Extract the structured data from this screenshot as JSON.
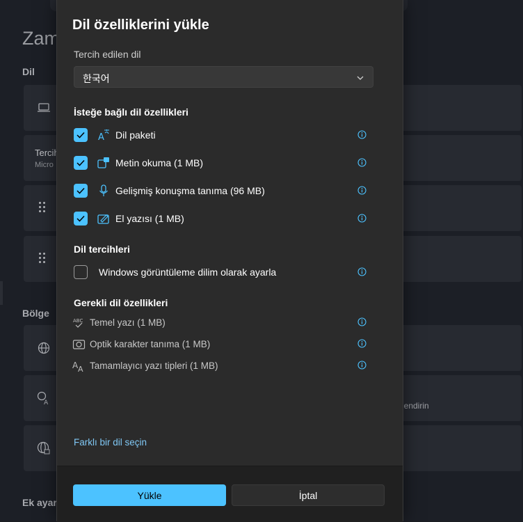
{
  "background": {
    "page_title": "Zam",
    "section_language": "Dil",
    "card_pref_title": "Tercih",
    "card_pref_sub": "Micro",
    "section_region": "Bölge",
    "card_region_text": "mlendirin",
    "section_extra": "Ek ayarl"
  },
  "dialog": {
    "title": "Dil özelliklerini yükle",
    "preferred_label": "Tercih edilen dil",
    "preferred_value": "한국어",
    "optional_heading": "İsteğe bağlı dil özellikleri",
    "optional_features": [
      {
        "label": "Dil paketi",
        "checked": true,
        "icon": "language-pack-icon"
      },
      {
        "label": "Metin okuma (1 MB)",
        "checked": true,
        "icon": "text-to-speech-icon"
      },
      {
        "label": "Gelişmiş konuşma tanıma (96 MB)",
        "checked": true,
        "icon": "microphone-icon"
      },
      {
        "label": "El yazısı (1 MB)",
        "checked": true,
        "icon": "handwriting-icon"
      }
    ],
    "preferences_heading": "Dil tercihleri",
    "display_language_option": {
      "label": "Windows görüntüleme dilim olarak ayarla",
      "checked": false
    },
    "required_heading": "Gerekli dil özellikleri",
    "required_features": [
      {
        "label": "Temel yazı (1 MB)",
        "icon": "basic-typing-icon"
      },
      {
        "label": "Optik karakter tanıma (1 MB)",
        "icon": "ocr-icon"
      },
      {
        "label": "Tamamlayıcı yazı tipleri (1 MB)",
        "icon": "fonts-icon"
      }
    ],
    "choose_other_link": "Farklı bir dil seçin",
    "install_button": "Yükle",
    "cancel_button": "İptal"
  },
  "colors": {
    "accent": "#4cc2ff",
    "dialog_bg": "#2b2b2b",
    "footer_bg": "#202020",
    "link": "#80c8f5"
  }
}
